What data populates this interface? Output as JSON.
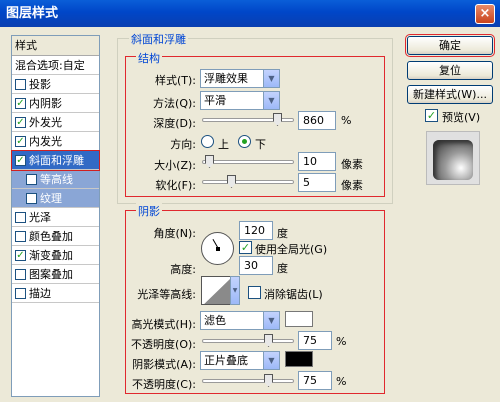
{
  "window": {
    "title": "图层样式",
    "close_glyph": "×"
  },
  "style_list": {
    "header": "样式",
    "blend_options": "混合选项:自定",
    "items": [
      {
        "label": "投影",
        "checked": false
      },
      {
        "label": "内阴影",
        "checked": true
      },
      {
        "label": "外发光",
        "checked": true
      },
      {
        "label": "内发光",
        "checked": true
      },
      {
        "label": "斜面和浮雕",
        "checked": true,
        "selected": true
      },
      {
        "label": "等高线",
        "checked": false,
        "sub": true
      },
      {
        "label": "纹理",
        "checked": false,
        "sub": true
      },
      {
        "label": "光泽",
        "checked": false
      },
      {
        "label": "颜色叠加",
        "checked": false
      },
      {
        "label": "渐变叠加",
        "checked": true
      },
      {
        "label": "图案叠加",
        "checked": false
      },
      {
        "label": "描边",
        "checked": false
      }
    ]
  },
  "bevel": {
    "title": "斜面和浮雕",
    "structure_title": "结构",
    "style_label": "样式(T):",
    "style_value": "浮雕效果",
    "technique_label": "方法(Q):",
    "technique_value": "平滑",
    "depth_label": "深度(D):",
    "depth_value": "860",
    "depth_unit": "%",
    "depth_pct": 0.86,
    "direction_label": "方向:",
    "dir_up": "上",
    "dir_down": "下",
    "direction_selected": "down",
    "size_label": "大小(Z):",
    "size_value": "10",
    "size_unit": "像素",
    "size_pct": 0.04,
    "soften_label": "软化(F):",
    "soften_value": "5",
    "soften_unit": "像素",
    "soften_pct": 0.3
  },
  "shading": {
    "title": "阴影",
    "angle_label": "角度(N):",
    "angle_value": "120",
    "angle_unit": "度",
    "global_light_label": "使用全局光(G)",
    "global_light": true,
    "altitude_label": "高度:",
    "altitude_value": "30",
    "altitude_unit": "度",
    "gloss_label": "光泽等高线:",
    "anti_alias_label": "消除锯齿(L)",
    "anti_alias": false,
    "highlight_mode_label": "高光模式(H):",
    "highlight_mode_value": "滤色",
    "highlight_color": "#ffffff",
    "highlight_opacity_label": "不透明度(O):",
    "highlight_opacity_value": "75",
    "highlight_opacity_unit": "%",
    "highlight_opacity_pct": 0.75,
    "shadow_mode_label": "阴影模式(A):",
    "shadow_mode_value": "正片叠底",
    "shadow_color": "#000000",
    "shadow_opacity_label": "不透明度(C):",
    "shadow_opacity_value": "75",
    "shadow_opacity_unit": "%",
    "shadow_opacity_pct": 0.75
  },
  "buttons": {
    "ok": "确定",
    "reset": "复位",
    "new_style": "新建样式(W)...",
    "preview_label": "预览(V)",
    "preview_checked": true
  }
}
